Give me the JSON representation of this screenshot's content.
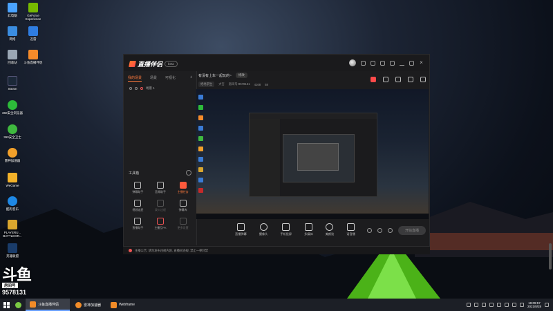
{
  "desktop_icons": [
    {
      "label": "此电脑",
      "color": "#4aa3ff"
    },
    {
      "label": "GeForce Experience",
      "color": "#76b900"
    },
    {
      "label": "网络",
      "color": "#3b8de0"
    },
    {
      "label": "迅雷",
      "color": "#2f7de1"
    },
    {
      "label": "回收站",
      "color": "#9aa7b5"
    },
    {
      "label": "斗鱼直播伴侣",
      "color": "#f58b2a"
    },
    {
      "label": "Steam",
      "color": "#1b2838"
    },
    {
      "label": "360安全浏览器",
      "color": "#2dbb3a"
    },
    {
      "label": "360安全卫士",
      "color": "#3fb93f"
    },
    {
      "label": "雷神加速器",
      "color": "#f2a02a"
    },
    {
      "label": "WeGame",
      "color": "#f3b22a"
    },
    {
      "label": "酷狗音乐",
      "color": "#1e88e5"
    },
    {
      "label": "PLAYERU... BATTLEGR...",
      "color": "#d9a62e"
    },
    {
      "label": "英雄联盟",
      "color": "#1a3c6a"
    },
    {
      "label": "完美世界竞技平台",
      "color": "#c52a2a"
    }
  ],
  "app": {
    "name": "直播伴侣",
    "version": "beta"
  },
  "sidebar": {
    "tabs": [
      "我的场景",
      "场景",
      "可视化"
    ],
    "scene": "场景 1",
    "tools_title": "工具箱",
    "tools": [
      {
        "label": "弹幕助手",
        "state": "normal"
      },
      {
        "label": "音频助手",
        "state": "normal"
      },
      {
        "label": "主播任务",
        "state": "hot"
      },
      {
        "label": "视频连麦",
        "state": "normal"
      },
      {
        "label": "录入过程",
        "state": "dim"
      },
      {
        "label": "弹幕库",
        "state": "normal"
      },
      {
        "label": "直播助手",
        "state": "normal"
      },
      {
        "label": "主播互PK",
        "state": "normal"
      },
      {
        "label": "更多设置",
        "state": "dim"
      }
    ]
  },
  "room": {
    "title": "有没有上车一起玩的~",
    "edit": "修改",
    "category": "绝地求生",
    "tag": "大吉",
    "room_id": "房间号:9578131",
    "hot": "4168",
    "fans": "58"
  },
  "tooltip": {
    "line1": "你的开播时长",
    "line2": "获得100Exp 主播经验"
  },
  "bottom_bar": {
    "buttons": [
      "直播弹幕",
      "摄像头",
      "手机投屏",
      "多媒体",
      "美颜贴",
      "语音播"
    ],
    "start_live": "开始直播"
  },
  "status": "主播公告: 请勿发布违规内容, 直播间违规, 禁止一律封禁",
  "watermark": {
    "brand": "斗鱼",
    "tag": "房间号",
    "room": "9578131"
  },
  "taskbar": {
    "apps": [
      "斗鱼直播伴侣",
      "雷神加速器",
      "Webframe"
    ],
    "time": "19:09:57",
    "date": "2021/8/28"
  }
}
